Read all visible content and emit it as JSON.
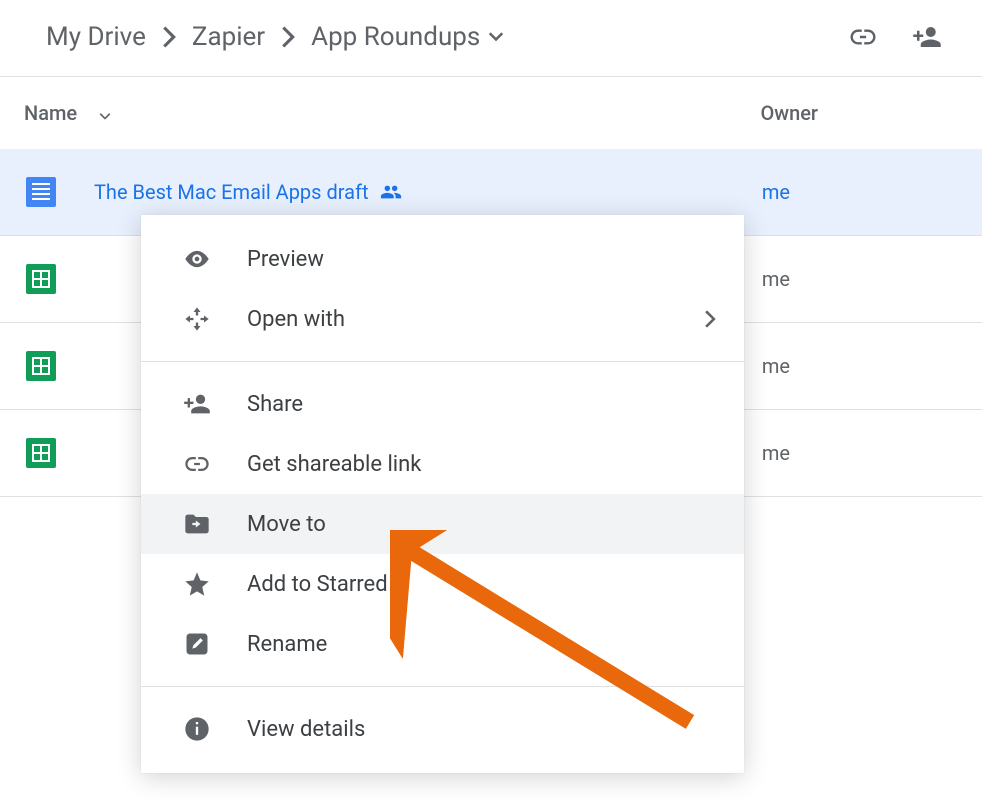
{
  "breadcrumb": {
    "root": "My Drive",
    "mid": "Zapier",
    "current": "App Roundups"
  },
  "columns": {
    "name": "Name",
    "owner": "Owner"
  },
  "files": [
    {
      "name": "The Best Mac Email Apps draft",
      "type": "doc",
      "owner": "me",
      "shared": true,
      "selected": true
    },
    {
      "name": "",
      "type": "sheet",
      "owner": "me",
      "shared": false,
      "selected": false
    },
    {
      "name": "",
      "type": "sheet",
      "owner": "me",
      "shared": false,
      "selected": false
    },
    {
      "name": "",
      "type": "sheet",
      "owner": "me",
      "shared": false,
      "selected": false
    }
  ],
  "menu": {
    "preview": "Preview",
    "openwith": "Open with",
    "share": "Share",
    "getlink": "Get shareable link",
    "moveto": "Move to",
    "star": "Add to Starred",
    "rename": "Rename",
    "details": "View details"
  }
}
